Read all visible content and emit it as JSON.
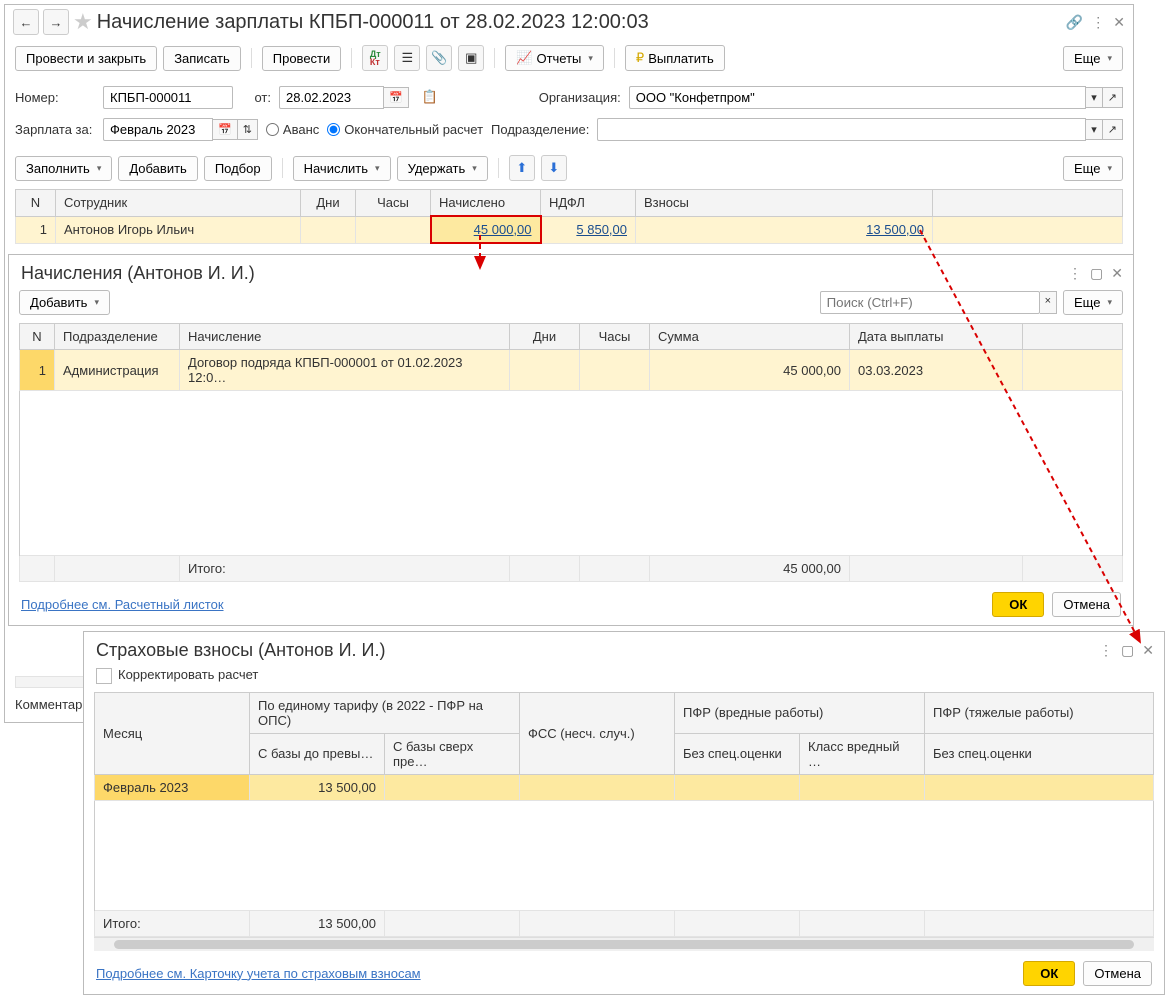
{
  "main": {
    "title": "Начисление зарплаты КПБП-000011 от 28.02.2023 12:00:03",
    "btn_post_close": "Провести и закрыть",
    "btn_save": "Записать",
    "btn_post": "Провести",
    "btn_reports": "Отчеты",
    "btn_pay": "Выплатить",
    "btn_more": "Еще",
    "lbl_number": "Номер:",
    "val_number": "КПБП-000011",
    "lbl_from": "от:",
    "val_date": "28.02.2023",
    "lbl_org": "Организация:",
    "val_org": "ООО \"Конфетпром\"",
    "lbl_period": "Зарплата за:",
    "val_period": "Февраль 2023",
    "radio_advance": "Аванс",
    "radio_final": "Окончательный расчет",
    "lbl_dept": "Подразделение:",
    "btn_fill": "Заполнить",
    "btn_add": "Добавить",
    "btn_pick": "Подбор",
    "btn_accrue": "Начислить",
    "btn_withhold": "Удержать",
    "th_n": "N",
    "th_emp": "Сотрудник",
    "th_days": "Дни",
    "th_hours": "Часы",
    "th_accrued": "Начислено",
    "th_ndfl": "НДФЛ",
    "th_contrib": "Взносы",
    "row1_n": "1",
    "row1_emp": "Антонов Игорь Ильич",
    "row1_accrued": "45 000,00",
    "row1_ndfl": "5 850,00",
    "row1_contrib": "13 500,00",
    "lbl_comment": "Комментарий"
  },
  "accruals": {
    "title": "Начисления (Антонов И. И.)",
    "btn_add": "Добавить",
    "search_ph": "Поиск (Ctrl+F)",
    "btn_more": "Еще",
    "th_n": "N",
    "th_dept": "Подразделение",
    "th_accrual": "Начисление",
    "th_days": "Дни",
    "th_hours": "Часы",
    "th_sum": "Сумма",
    "th_paydate": "Дата выплаты",
    "r1_n": "1",
    "r1_dept": "Администрация",
    "r1_accr": "Договор подряда КПБП-000001 от 01.02.2023 12:0…",
    "r1_sum": "45 000,00",
    "r1_date": "03.03.2023",
    "total_lbl": "Итого:",
    "total_sum": "45 000,00",
    "link_slip": "Подробнее см. Расчетный листок",
    "btn_ok": "ОК",
    "btn_cancel": "Отмена"
  },
  "contrib": {
    "title": "Страховые взносы (Антонов И. И.)",
    "chk_correct": "Корректировать расчет",
    "th_month": "Месяц",
    "th_tariff": "По единому тарифу (в 2022 - ПФР на ОПС)",
    "th_base_before": "С базы до превы…",
    "th_base_above": "С базы сверх пре…",
    "th_fss": "ФСС (несч. случ.)",
    "th_pfr_harm": "ПФР (вредные работы)",
    "th_no_assess1": "Без спец.оценки",
    "th_class_harm": "Класс вредный …",
    "th_pfr_heavy": "ПФР (тяжелые работы)",
    "th_no_assess2": "Без спец.оценки",
    "r1_month": "Февраль 2023",
    "r1_val": "13 500,00",
    "total_lbl": "Итого:",
    "total_val": "13 500,00",
    "link_card": "Подробнее см. Карточку учета по страховым взносам",
    "btn_ok": "ОК",
    "btn_cancel": "Отмена"
  }
}
